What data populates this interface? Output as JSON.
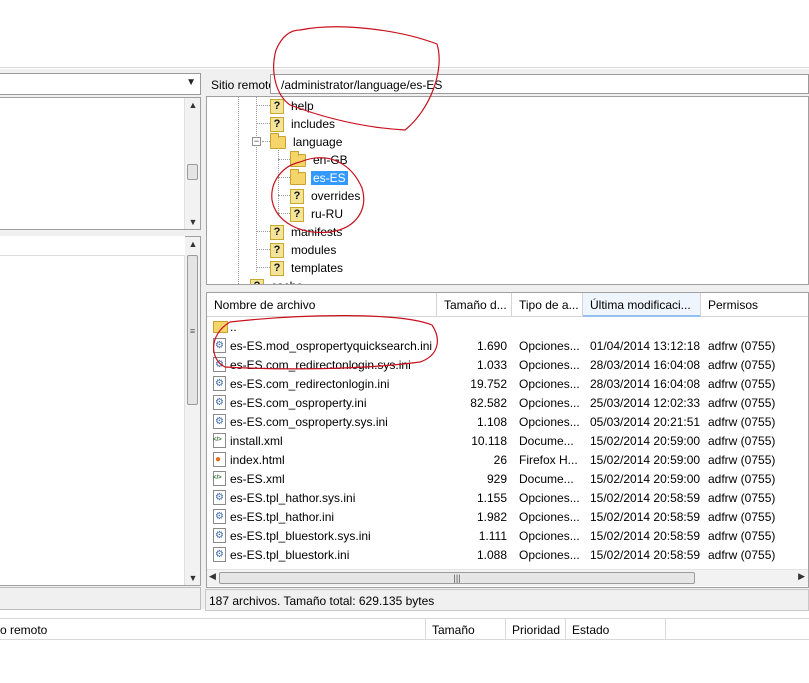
{
  "remote": {
    "label": "Sitio remoto:",
    "path": "/administrator/language/es-ES"
  },
  "tree": {
    "items": [
      {
        "name": "help",
        "icon": "question-folder-icon"
      },
      {
        "name": "includes",
        "icon": "question-folder-icon"
      },
      {
        "name": "language",
        "icon": "folder-icon"
      },
      {
        "name": "en-GB",
        "icon": "folder-icon"
      },
      {
        "name": "es-ES",
        "icon": "folder-icon",
        "selected": true
      },
      {
        "name": "overrides",
        "icon": "question-folder-icon"
      },
      {
        "name": "ru-RU",
        "icon": "question-folder-icon"
      },
      {
        "name": "manifests",
        "icon": "question-folder-icon"
      },
      {
        "name": "modules",
        "icon": "question-folder-icon"
      },
      {
        "name": "templates",
        "icon": "question-folder-icon"
      },
      {
        "name": "cache",
        "icon": "question-folder-icon"
      }
    ]
  },
  "files": {
    "columns": [
      "Nombre de archivo",
      "Tamaño d...",
      "Tipo de a...",
      "Última modificaci...",
      "Permisos"
    ],
    "rows": [
      {
        "name": "..",
        "size": "",
        "type": "",
        "modified": "",
        "perm": "",
        "icon": "folder-icon"
      },
      {
        "name": "es-ES.mod_ospropertyquicksearch.ini",
        "size": "1.690",
        "type": "Opciones...",
        "modified": "01/04/2014 13:12:18",
        "perm": "adfrw (0755)",
        "icon": "ini-file-icon"
      },
      {
        "name": "es-ES.com_redirectonlogin.sys.ini",
        "size": "1.033",
        "type": "Opciones...",
        "modified": "28/03/2014 16:04:08",
        "perm": "adfrw (0755)",
        "icon": "ini-file-icon"
      },
      {
        "name": "es-ES.com_redirectonlogin.ini",
        "size": "19.752",
        "type": "Opciones...",
        "modified": "28/03/2014 16:04:08",
        "perm": "adfrw (0755)",
        "icon": "ini-file-icon"
      },
      {
        "name": "es-ES.com_osproperty.ini",
        "size": "82.582",
        "type": "Opciones...",
        "modified": "25/03/2014 12:02:33",
        "perm": "adfrw (0755)",
        "icon": "ini-file-icon"
      },
      {
        "name": "es-ES.com_osproperty.sys.ini",
        "size": "1.108",
        "type": "Opciones...",
        "modified": "05/03/2014 20:21:51",
        "perm": "adfrw (0755)",
        "icon": "ini-file-icon"
      },
      {
        "name": "install.xml",
        "size": "10.118",
        "type": "Docume...",
        "modified": "15/02/2014 20:59:00",
        "perm": "adfrw (0755)",
        "icon": "xml-file-icon"
      },
      {
        "name": "index.html",
        "size": "26",
        "type": "Firefox H...",
        "modified": "15/02/2014 20:59:00",
        "perm": "adfrw (0755)",
        "icon": "html-file-icon"
      },
      {
        "name": "es-ES.xml",
        "size": "929",
        "type": "Docume...",
        "modified": "15/02/2014 20:59:00",
        "perm": "adfrw (0755)",
        "icon": "xml-file-icon"
      },
      {
        "name": "es-ES.tpl_hathor.sys.ini",
        "size": "1.155",
        "type": "Opciones...",
        "modified": "15/02/2014 20:58:59",
        "perm": "adfrw (0755)",
        "icon": "ini-file-icon"
      },
      {
        "name": "es-ES.tpl_hathor.ini",
        "size": "1.982",
        "type": "Opciones...",
        "modified": "15/02/2014 20:58:59",
        "perm": "adfrw (0755)",
        "icon": "ini-file-icon"
      },
      {
        "name": "es-ES.tpl_bluestork.sys.ini",
        "size": "1.111",
        "type": "Opciones...",
        "modified": "15/02/2014 20:58:59",
        "perm": "adfrw (0755)",
        "icon": "ini-file-icon"
      },
      {
        "name": "es-ES.tpl_bluestork.ini",
        "size": "1.088",
        "type": "Opciones...",
        "modified": "15/02/2014 20:58:59",
        "perm": "adfrw (0755)",
        "icon": "ini-file-icon"
      }
    ]
  },
  "status": {
    "text": "187 archivos. Tamaño total: 629.135 bytes"
  },
  "queue": {
    "columns": [
      "o remoto",
      "Tamaño",
      "Prioridad",
      "Estado"
    ]
  },
  "colors": {
    "selection": "#3399ff",
    "annotation_ink": "#c8101e"
  }
}
